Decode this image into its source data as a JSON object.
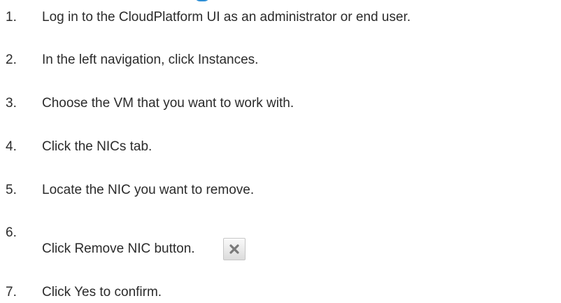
{
  "steps": [
    {
      "number": "1.",
      "text": "Log in to the CloudPlatform UI as an administrator or end user."
    },
    {
      "number": "2.",
      "text": "In the left navigation, click Instances."
    },
    {
      "number": "3.",
      "text": "Choose the VM that you want to work with."
    },
    {
      "number": "4.",
      "text": "Click the NICs tab."
    },
    {
      "number": "5.",
      "text": "Locate the NIC you want to remove."
    },
    {
      "number": "6.",
      "text": "Click Remove NIC button.",
      "icon": "remove-x-icon"
    },
    {
      "number": "7.",
      "text": "Click Yes to confirm."
    }
  ],
  "colors": {
    "text": "#2b2b2b",
    "heading_accent": "#2e8fd6",
    "icon_glyph": "#7a7a7a"
  }
}
